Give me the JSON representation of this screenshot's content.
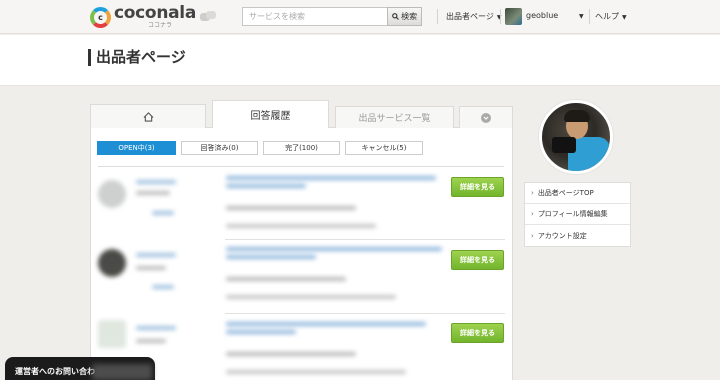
{
  "header": {
    "logo_text": "coconala",
    "logo_kana": "ココナラ",
    "search_placeholder": "サービスを検索",
    "search_button": "検索",
    "seller_page": "出品者ページ",
    "username": "geoblue",
    "help": "ヘルプ"
  },
  "page": {
    "title": "出品者ページ"
  },
  "tabs": [
    {
      "label": "",
      "icon": "home-icon"
    },
    {
      "label": "回答履歴"
    },
    {
      "label": "出品サービス一覧"
    },
    {
      "label": "",
      "icon": "chevron-down-circle-icon"
    }
  ],
  "filters": [
    {
      "label": "OPEN中(3)",
      "active": true
    },
    {
      "label": "回答済み(0)"
    },
    {
      "label": "完了(100)"
    },
    {
      "label": "キャンセル(5)"
    }
  ],
  "rows": [
    {
      "button": "詳細を見る"
    },
    {
      "button": "詳細を見る"
    },
    {
      "button": "詳細を見る"
    }
  ],
  "sidebar": {
    "items": [
      {
        "label": "出品者ページTOP"
      },
      {
        "label": "プロフィール情報編集"
      },
      {
        "label": "アカウント設定"
      }
    ]
  },
  "contact": {
    "label": "運営者へのお問い合わ"
  },
  "colors": {
    "accent_blue": "#1e8fd4",
    "button_green": "#7cbb33"
  }
}
